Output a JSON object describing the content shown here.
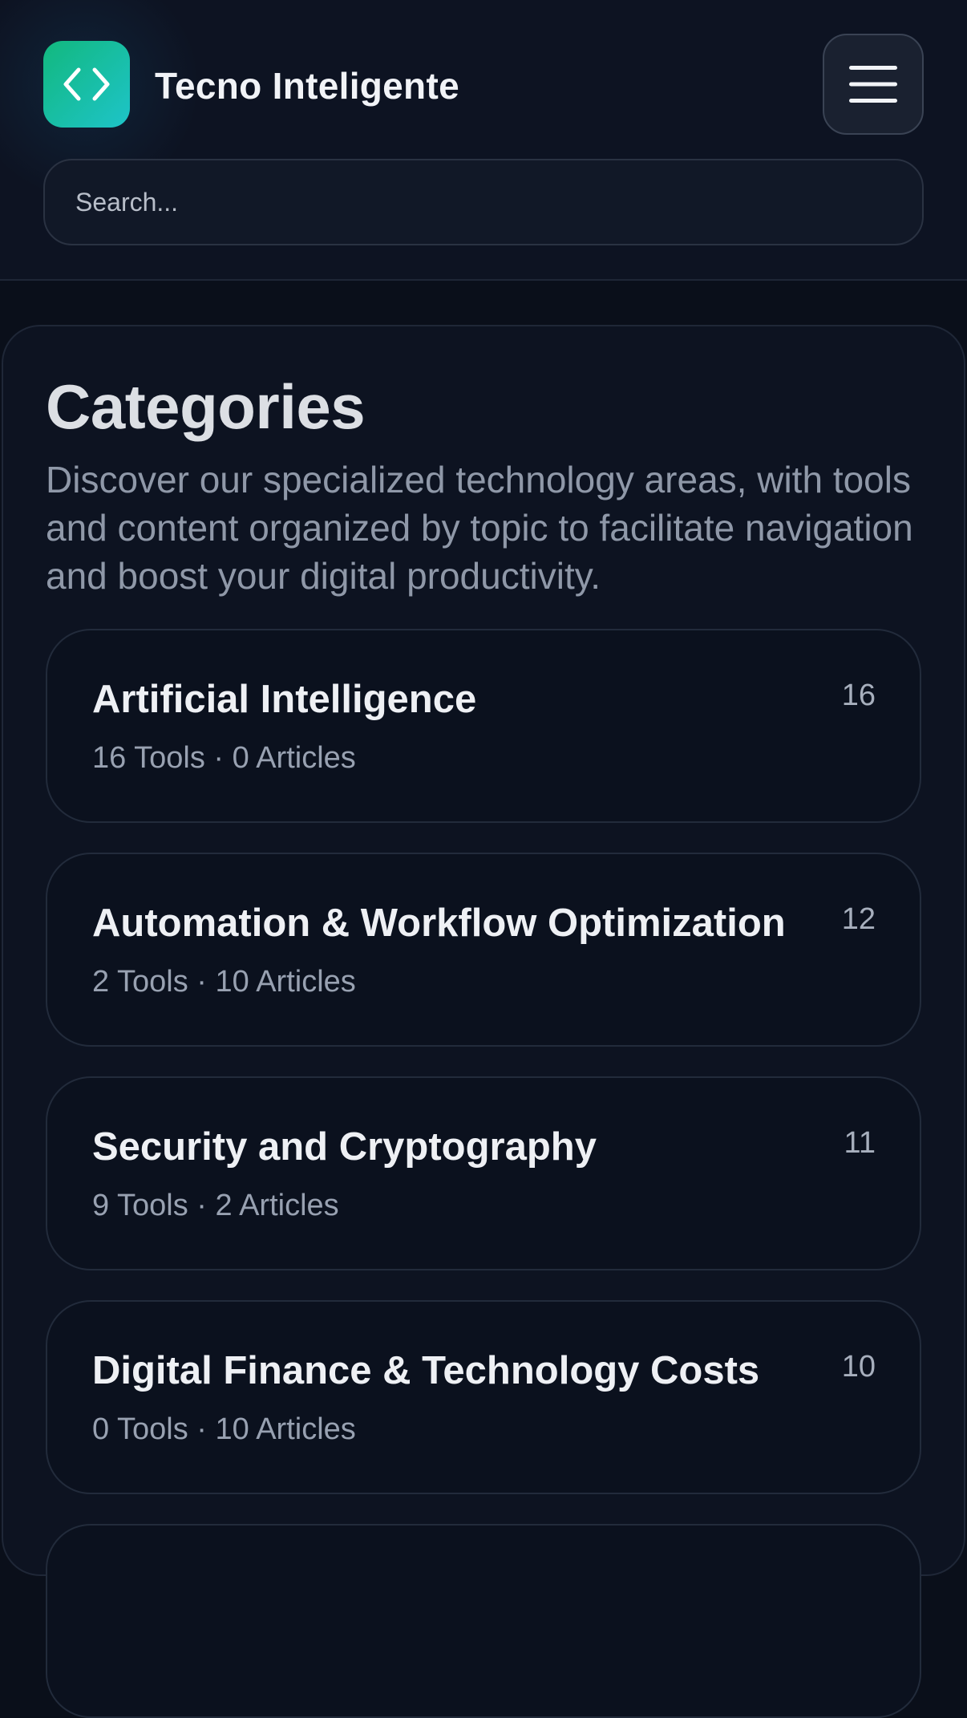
{
  "header": {
    "brand": "Tecno Inteligente",
    "logo_icon": "code-brackets-icon",
    "menu_icon": "hamburger-menu-icon",
    "accent_gradient": [
      "#12b87e",
      "#1ec4c9"
    ]
  },
  "search": {
    "placeholder": "Search..."
  },
  "main": {
    "title": "Categories",
    "description": "Discover our specialized technology areas, with tools and content organized by topic to facilitate navigation and boost your digital productivity."
  },
  "categories": [
    {
      "name": "Artificial Intelligence",
      "meta": "16 Tools · 0 Articles",
      "count": "16"
    },
    {
      "name": "Automation & Workflow Optimization",
      "meta": "2 Tools · 10 Articles",
      "count": "12"
    },
    {
      "name": "Security and Cryptography",
      "meta": "9 Tools · 2 Articles",
      "count": "11"
    },
    {
      "name": "Digital Finance & Technology Costs",
      "meta": "0 Tools · 10 Articles",
      "count": "10"
    }
  ]
}
